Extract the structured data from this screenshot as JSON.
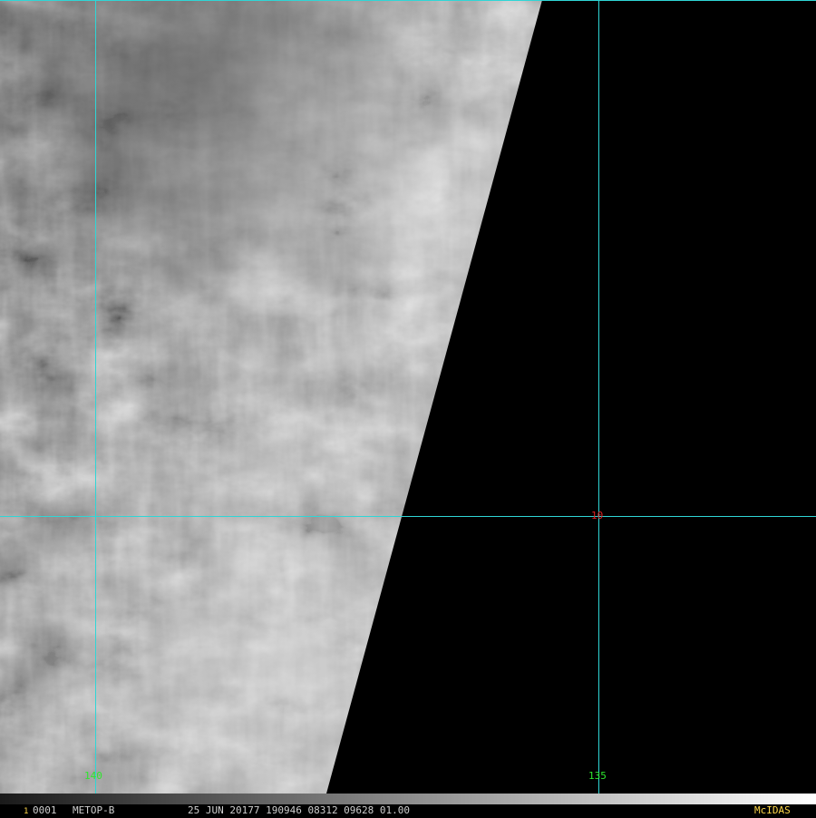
{
  "colors": {
    "grid": "#2fd6d6",
    "lon_label": "#2ee62e",
    "lat_label": "#e02020",
    "status_text": "#cfcfcf",
    "frame_marker": "#ffd84a",
    "brand": "#ffd84a",
    "background": "#000000"
  },
  "grid": {
    "lon_labels": [
      "140",
      "135"
    ],
    "lat_labels": [
      "10"
    ]
  },
  "status": {
    "frame_marker": "1",
    "frame_number": "0001",
    "satellite": "METOP-B",
    "info": "25 JUN 20177 190946 08312 09628 01.00",
    "brand": "McIDAS"
  }
}
